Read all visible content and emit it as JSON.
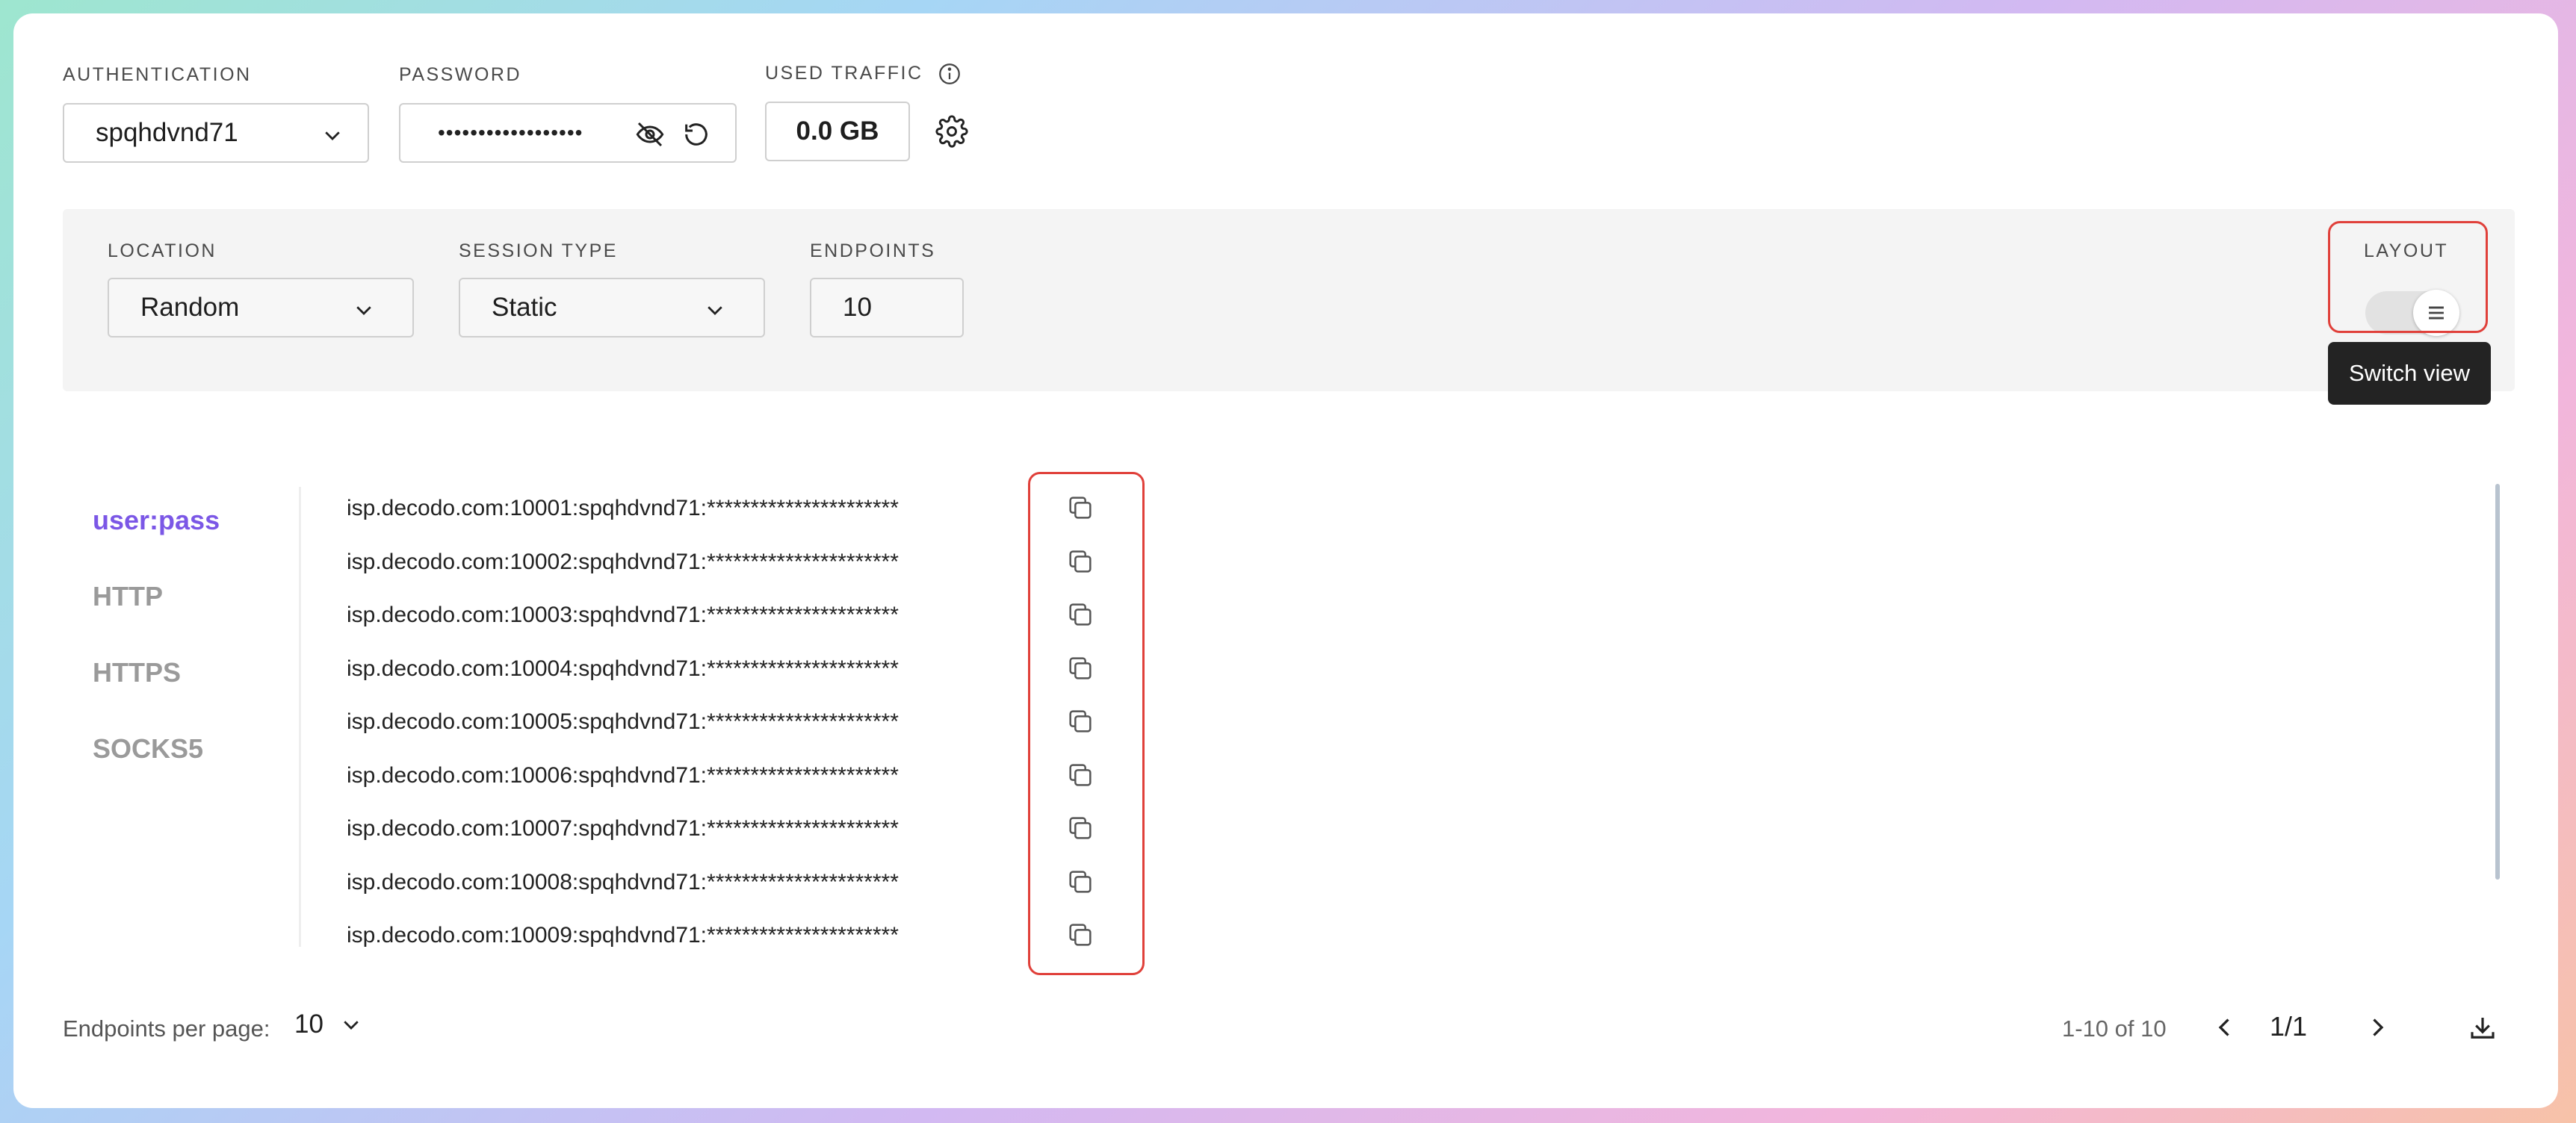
{
  "auth": {
    "label": "AUTHENTICATION",
    "value": "spqhdvnd71"
  },
  "password": {
    "label": "PASSWORD",
    "value": "••••••••••••••••••"
  },
  "traffic": {
    "label": "USED TRAFFIC",
    "value": "0.0 GB"
  },
  "filters": {
    "location_label": "LOCATION",
    "location_value": "Random",
    "session_label": "SESSION TYPE",
    "session_value": "Static",
    "endpoints_label": "ENDPOINTS",
    "endpoints_value": "10",
    "layout_label": "LAYOUT",
    "tooltip": "Switch view"
  },
  "formats": [
    "user:pass",
    "HTTP",
    "HTTPS",
    "SOCKS5"
  ],
  "endpoints": [
    "isp.decodo.com:10001:spqhdvnd71:**********************",
    "isp.decodo.com:10002:spqhdvnd71:**********************",
    "isp.decodo.com:10003:spqhdvnd71:**********************",
    "isp.decodo.com:10004:spqhdvnd71:**********************",
    "isp.decodo.com:10005:spqhdvnd71:**********************",
    "isp.decodo.com:10006:spqhdvnd71:**********************",
    "isp.decodo.com:10007:spqhdvnd71:**********************",
    "isp.decodo.com:10008:spqhdvnd71:**********************",
    "isp.decodo.com:10009:spqhdvnd71:**********************"
  ],
  "footer": {
    "per_page_label": "Endpoints per page:",
    "per_page_value": "10",
    "range": "1-10 of 10",
    "page": "1/1"
  },
  "colors": {
    "accent": "#7b57e6",
    "highlight": "#e0403a"
  }
}
